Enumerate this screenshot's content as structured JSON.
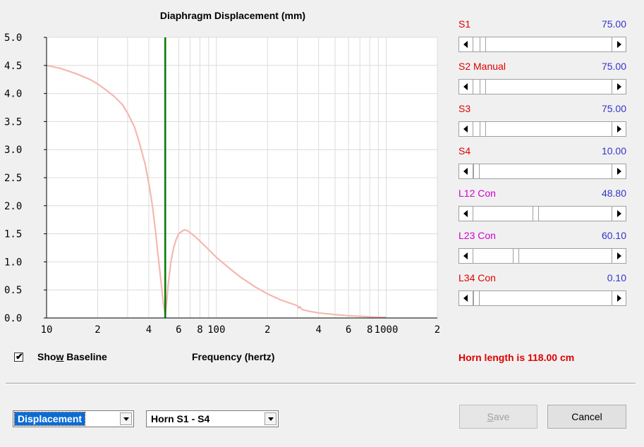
{
  "chart_data": {
    "type": "line",
    "title": "Diaphragm Displacement (mm)",
    "xlabel": "Frequency (hertz)",
    "ylabel": "",
    "x_scale": "log",
    "xlim": [
      10,
      2000
    ],
    "ylim": [
      0,
      5
    ],
    "x_tick_labels": [
      "10",
      "2",
      "4",
      "6",
      "8",
      "100",
      "2",
      "4",
      "6",
      "8",
      "1000",
      "2"
    ],
    "x_tick_values": [
      10,
      20,
      40,
      60,
      80,
      100,
      200,
      400,
      600,
      800,
      1000,
      2000
    ],
    "y_tick_labels": [
      "5.0",
      "4.5",
      "4.0",
      "3.5",
      "3.0",
      "2.5",
      "2.0",
      "1.5",
      "1.0",
      "0.5",
      "0.0"
    ],
    "y_tick_values": [
      5.0,
      4.5,
      4.0,
      3.5,
      3.0,
      2.5,
      2.0,
      1.5,
      1.0,
      0.5,
      0.0
    ],
    "marker_line": {
      "x": 50,
      "color": "#007a00"
    },
    "series": [
      {
        "color": "#f4b8b0",
        "x": [
          10,
          12,
          15,
          18,
          20,
          22,
          25,
          28,
          30,
          33,
          35,
          38,
          40,
          42,
          44,
          45,
          46,
          47,
          48,
          49,
          50,
          51,
          52,
          54,
          56,
          58,
          60,
          63,
          65,
          68,
          70,
          75,
          80,
          90,
          100,
          120,
          140,
          170,
          200,
          240,
          280,
          300,
          305,
          310,
          320,
          350,
          400,
          500,
          600,
          700,
          800,
          1000
        ],
        "y": [
          4.5,
          4.45,
          4.35,
          4.25,
          4.17,
          4.08,
          3.95,
          3.8,
          3.65,
          3.4,
          3.15,
          2.75,
          2.4,
          2.0,
          1.5,
          1.2,
          0.95,
          0.7,
          0.45,
          0.2,
          0.05,
          0.3,
          0.6,
          1.0,
          1.25,
          1.4,
          1.5,
          1.55,
          1.57,
          1.55,
          1.52,
          1.45,
          1.37,
          1.22,
          1.08,
          0.88,
          0.72,
          0.55,
          0.43,
          0.32,
          0.25,
          0.22,
          0.18,
          0.2,
          0.15,
          0.12,
          0.09,
          0.06,
          0.04,
          0.03,
          0.02,
          0.01
        ]
      }
    ]
  },
  "controls": {
    "show_baseline": {
      "label_pre": "Sho",
      "label_ul": "w",
      "label_post": " Baseline",
      "checked": true,
      "check_glyph": "✔"
    },
    "horn_length": "Horn length is 118.00 cm",
    "sliders": [
      {
        "name": "S1",
        "value": "75.00",
        "fraction": 0.05,
        "color": "#e00000"
      },
      {
        "name": "S2 Manual",
        "value": "75.00",
        "fraction": 0.05,
        "color": "#e00000"
      },
      {
        "name": "S3",
        "value": "75.00",
        "fraction": 0.05,
        "color": "#e00000"
      },
      {
        "name": "S4",
        "value": "10.00",
        "fraction": 0.0,
        "color": "#e00000"
      },
      {
        "name": "L12 Con",
        "value": "48.80",
        "fraction": 0.45,
        "color": "#d000d0"
      },
      {
        "name": "L23 Con",
        "value": "60.10",
        "fraction": 0.3,
        "color": "#d000d0"
      },
      {
        "name": "L34 Con",
        "value": "0.10",
        "fraction": 0.0,
        "color": "#e00000"
      }
    ]
  },
  "bottom": {
    "display_select": "Displacement",
    "horn_select": "Horn S1 - S4",
    "save_pre": "",
    "save_ul": "S",
    "save_post": "ave",
    "cancel": "Cancel"
  },
  "colors": {
    "accent_red": "#e00000",
    "value_blue": "#3333cc",
    "magenta": "#d000d0",
    "marker_green": "#007a00",
    "curve": "#f4b8b0"
  }
}
